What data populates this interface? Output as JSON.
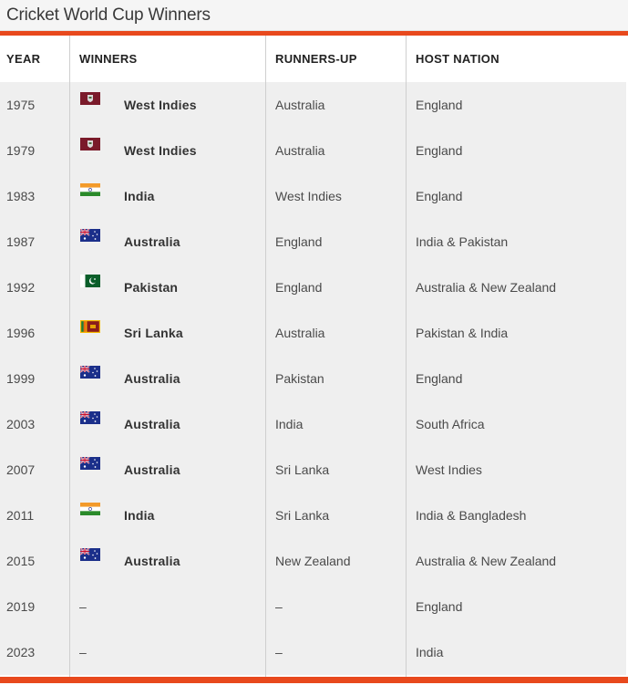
{
  "title": "Cricket World Cup Winners",
  "colors": {
    "accent": "#e8491d",
    "row_bg": "#efefef"
  },
  "headers": {
    "year": "YEAR",
    "winners": "WINNERS",
    "runners_up": "RUNNERS-UP",
    "host": "HOST NATION"
  },
  "rows": [
    {
      "year": "1975",
      "winner": "West Indies",
      "flag": "west-indies-flag",
      "runner_up": "Australia",
      "host": "England"
    },
    {
      "year": "1979",
      "winner": "West Indies",
      "flag": "west-indies-flag",
      "runner_up": "Australia",
      "host": "England"
    },
    {
      "year": "1983",
      "winner": "India",
      "flag": "india-flag",
      "runner_up": "West Indies",
      "host": "England"
    },
    {
      "year": "1987",
      "winner": "Australia",
      "flag": "australia-flag",
      "runner_up": "England",
      "host": "India & Pakistan"
    },
    {
      "year": "1992",
      "winner": "Pakistan",
      "flag": "pakistan-flag",
      "runner_up": "England",
      "host": "Australia & New Zealand"
    },
    {
      "year": "1996",
      "winner": "Sri Lanka",
      "flag": "sri-lanka-flag",
      "runner_up": "Australia",
      "host": "Pakistan & India"
    },
    {
      "year": "1999",
      "winner": "Australia",
      "flag": "australia-flag",
      "runner_up": "Pakistan",
      "host": "England"
    },
    {
      "year": "2003",
      "winner": "Australia",
      "flag": "australia-flag",
      "runner_up": "India",
      "host": "South Africa"
    },
    {
      "year": "2007",
      "winner": "Australia",
      "flag": "australia-flag",
      "runner_up": "Sri Lanka",
      "host": "West Indies"
    },
    {
      "year": "2011",
      "winner": "India",
      "flag": "india-flag",
      "runner_up": "Sri Lanka",
      "host": "India & Bangladesh"
    },
    {
      "year": "2015",
      "winner": "Australia",
      "flag": "australia-flag",
      "runner_up": "New Zealand",
      "host": "Australia & New Zealand"
    },
    {
      "year": "2019",
      "winner": "–",
      "flag": "",
      "runner_up": "–",
      "host": "England"
    },
    {
      "year": "2023",
      "winner": "–",
      "flag": "",
      "runner_up": "–",
      "host": "India"
    }
  ]
}
